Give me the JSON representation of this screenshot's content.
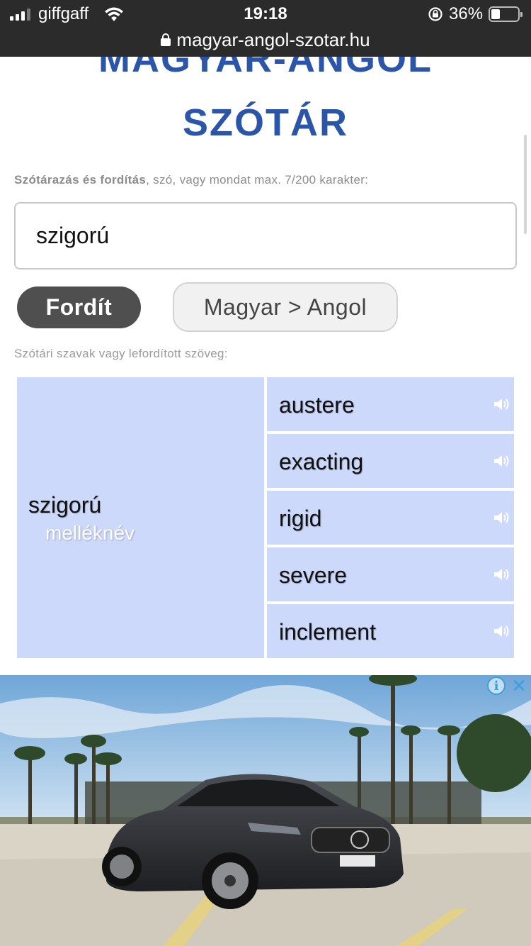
{
  "status_bar": {
    "carrier": "giffgaff",
    "time": "19:18",
    "battery_percent": "36%",
    "battery_level": 0.36
  },
  "url_bar": {
    "url": "magyar-angol-szotar.hu"
  },
  "header": {
    "title_line1": "MAGYAR-ANGOL",
    "title_line2": "SZÓTÁR"
  },
  "search": {
    "hint_bold": "Szótárazás és fordítás",
    "hint_rest": ", szó, vagy mondat max. 7/200 karakter:",
    "value": "szigorú",
    "translate_button": "Fordít",
    "direction_button": "Magyar > Angol"
  },
  "results": {
    "hint": "Szótári szavak vagy lefordított szöveg:",
    "source_word": "szigorú",
    "part_of_speech": "melléknév",
    "translations": [
      "austere",
      "exacting",
      "rigid",
      "severe",
      "inclement"
    ]
  },
  "ad": {
    "info_icon": "info-icon",
    "close_icon": "close-icon",
    "colors": {
      "sky": "#9cc3e6",
      "ground": "#d8d4c8",
      "car": "#2d2f33"
    }
  },
  "colors": {
    "title_blue": "#2a55a8",
    "result_bg": "#cdd9fb",
    "button_dark": "#4f4f4f"
  }
}
